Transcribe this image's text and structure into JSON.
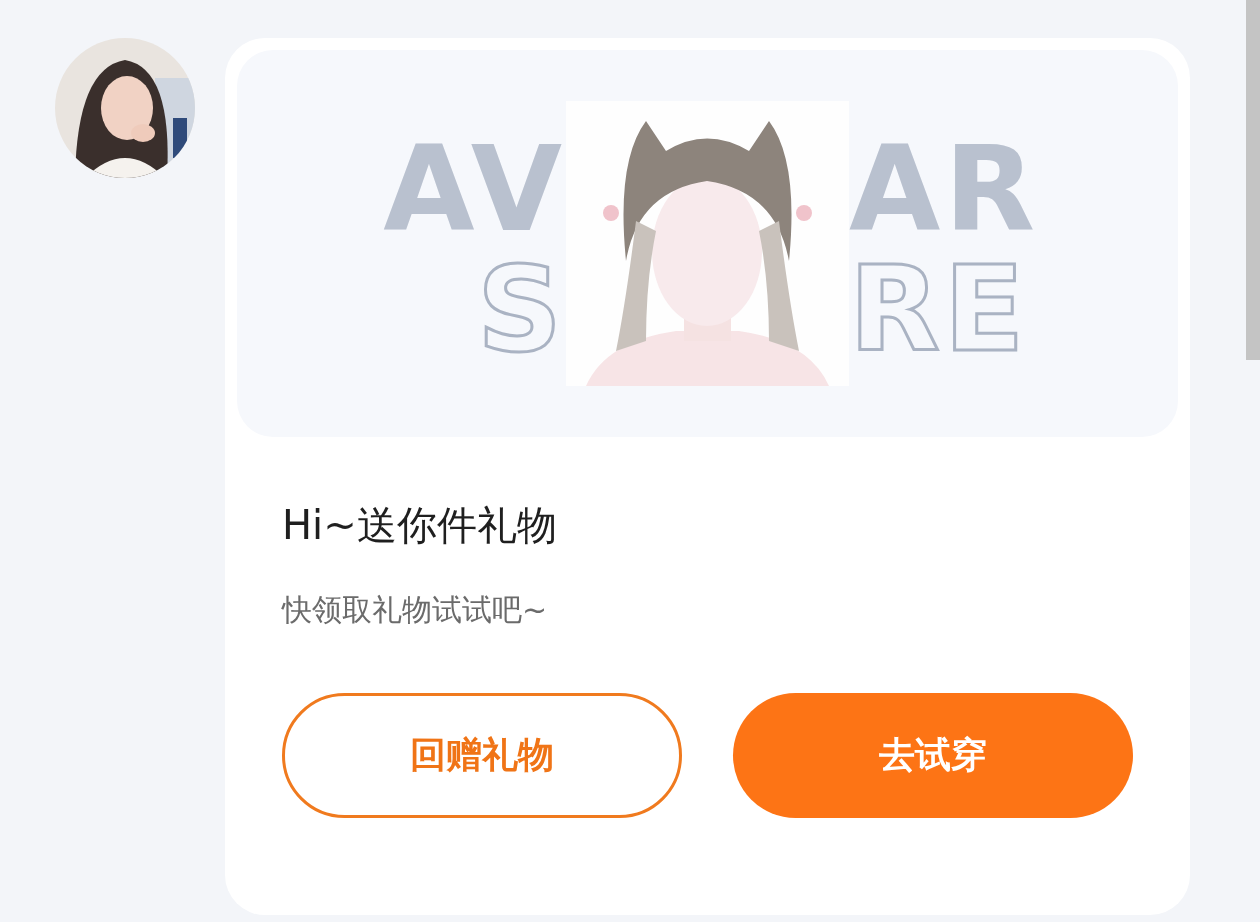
{
  "card": {
    "banner": {
      "backdrop_left": [
        "AV",
        "S"
      ],
      "backdrop_right": [
        "AR",
        "RE"
      ]
    },
    "title": "Hi~送你件礼物",
    "subtitle": "快领取礼物试试吧~",
    "buttons": [
      {
        "label": "回赠礼物",
        "kind": "outline"
      },
      {
        "label": "去试穿",
        "kind": "filled"
      }
    ]
  }
}
